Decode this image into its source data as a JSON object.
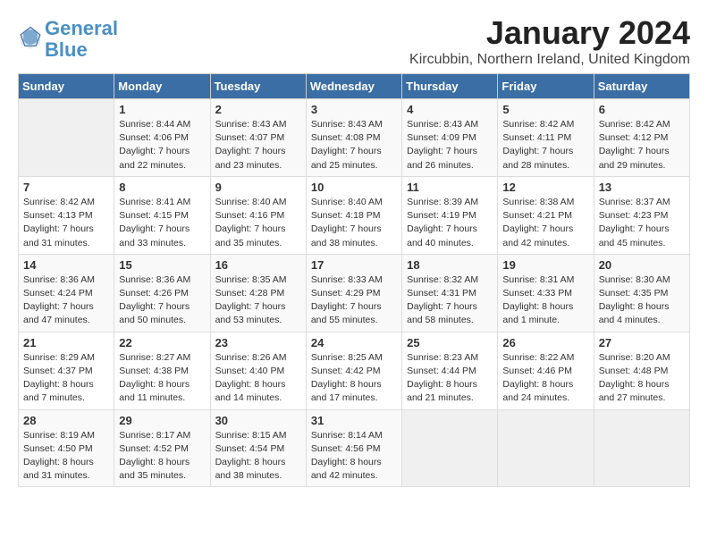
{
  "header": {
    "logo_line1": "General",
    "logo_line2": "Blue",
    "month_title": "January 2024",
    "subtitle": "Kircubbin, Northern Ireland, United Kingdom"
  },
  "weekdays": [
    "Sunday",
    "Monday",
    "Tuesday",
    "Wednesday",
    "Thursday",
    "Friday",
    "Saturday"
  ],
  "weeks": [
    [
      {
        "day": "",
        "info": ""
      },
      {
        "day": "1",
        "info": "Sunrise: 8:44 AM\nSunset: 4:06 PM\nDaylight: 7 hours\nand 22 minutes."
      },
      {
        "day": "2",
        "info": "Sunrise: 8:43 AM\nSunset: 4:07 PM\nDaylight: 7 hours\nand 23 minutes."
      },
      {
        "day": "3",
        "info": "Sunrise: 8:43 AM\nSunset: 4:08 PM\nDaylight: 7 hours\nand 25 minutes."
      },
      {
        "day": "4",
        "info": "Sunrise: 8:43 AM\nSunset: 4:09 PM\nDaylight: 7 hours\nand 26 minutes."
      },
      {
        "day": "5",
        "info": "Sunrise: 8:42 AM\nSunset: 4:11 PM\nDaylight: 7 hours\nand 28 minutes."
      },
      {
        "day": "6",
        "info": "Sunrise: 8:42 AM\nSunset: 4:12 PM\nDaylight: 7 hours\nand 29 minutes."
      }
    ],
    [
      {
        "day": "7",
        "info": "Sunrise: 8:42 AM\nSunset: 4:13 PM\nDaylight: 7 hours\nand 31 minutes."
      },
      {
        "day": "8",
        "info": "Sunrise: 8:41 AM\nSunset: 4:15 PM\nDaylight: 7 hours\nand 33 minutes."
      },
      {
        "day": "9",
        "info": "Sunrise: 8:40 AM\nSunset: 4:16 PM\nDaylight: 7 hours\nand 35 minutes."
      },
      {
        "day": "10",
        "info": "Sunrise: 8:40 AM\nSunset: 4:18 PM\nDaylight: 7 hours\nand 38 minutes."
      },
      {
        "day": "11",
        "info": "Sunrise: 8:39 AM\nSunset: 4:19 PM\nDaylight: 7 hours\nand 40 minutes."
      },
      {
        "day": "12",
        "info": "Sunrise: 8:38 AM\nSunset: 4:21 PM\nDaylight: 7 hours\nand 42 minutes."
      },
      {
        "day": "13",
        "info": "Sunrise: 8:37 AM\nSunset: 4:23 PM\nDaylight: 7 hours\nand 45 minutes."
      }
    ],
    [
      {
        "day": "14",
        "info": "Sunrise: 8:36 AM\nSunset: 4:24 PM\nDaylight: 7 hours\nand 47 minutes."
      },
      {
        "day": "15",
        "info": "Sunrise: 8:36 AM\nSunset: 4:26 PM\nDaylight: 7 hours\nand 50 minutes."
      },
      {
        "day": "16",
        "info": "Sunrise: 8:35 AM\nSunset: 4:28 PM\nDaylight: 7 hours\nand 53 minutes."
      },
      {
        "day": "17",
        "info": "Sunrise: 8:33 AM\nSunset: 4:29 PM\nDaylight: 7 hours\nand 55 minutes."
      },
      {
        "day": "18",
        "info": "Sunrise: 8:32 AM\nSunset: 4:31 PM\nDaylight: 7 hours\nand 58 minutes."
      },
      {
        "day": "19",
        "info": "Sunrise: 8:31 AM\nSunset: 4:33 PM\nDaylight: 8 hours\nand 1 minute."
      },
      {
        "day": "20",
        "info": "Sunrise: 8:30 AM\nSunset: 4:35 PM\nDaylight: 8 hours\nand 4 minutes."
      }
    ],
    [
      {
        "day": "21",
        "info": "Sunrise: 8:29 AM\nSunset: 4:37 PM\nDaylight: 8 hours\nand 7 minutes."
      },
      {
        "day": "22",
        "info": "Sunrise: 8:27 AM\nSunset: 4:38 PM\nDaylight: 8 hours\nand 11 minutes."
      },
      {
        "day": "23",
        "info": "Sunrise: 8:26 AM\nSunset: 4:40 PM\nDaylight: 8 hours\nand 14 minutes."
      },
      {
        "day": "24",
        "info": "Sunrise: 8:25 AM\nSunset: 4:42 PM\nDaylight: 8 hours\nand 17 minutes."
      },
      {
        "day": "25",
        "info": "Sunrise: 8:23 AM\nSunset: 4:44 PM\nDaylight: 8 hours\nand 21 minutes."
      },
      {
        "day": "26",
        "info": "Sunrise: 8:22 AM\nSunset: 4:46 PM\nDaylight: 8 hours\nand 24 minutes."
      },
      {
        "day": "27",
        "info": "Sunrise: 8:20 AM\nSunset: 4:48 PM\nDaylight: 8 hours\nand 27 minutes."
      }
    ],
    [
      {
        "day": "28",
        "info": "Sunrise: 8:19 AM\nSunset: 4:50 PM\nDaylight: 8 hours\nand 31 minutes."
      },
      {
        "day": "29",
        "info": "Sunrise: 8:17 AM\nSunset: 4:52 PM\nDaylight: 8 hours\nand 35 minutes."
      },
      {
        "day": "30",
        "info": "Sunrise: 8:15 AM\nSunset: 4:54 PM\nDaylight: 8 hours\nand 38 minutes."
      },
      {
        "day": "31",
        "info": "Sunrise: 8:14 AM\nSunset: 4:56 PM\nDaylight: 8 hours\nand 42 minutes."
      },
      {
        "day": "",
        "info": ""
      },
      {
        "day": "",
        "info": ""
      },
      {
        "day": "",
        "info": ""
      }
    ]
  ]
}
